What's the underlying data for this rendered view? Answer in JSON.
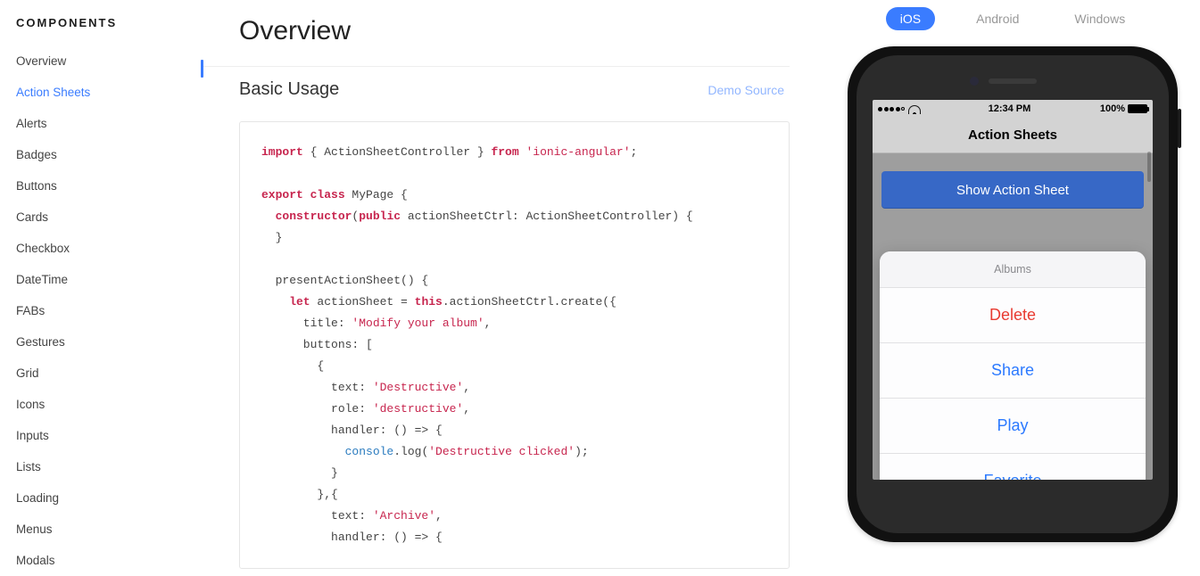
{
  "sidebar": {
    "title": "COMPONENTS",
    "items": [
      {
        "label": "Overview",
        "active": false
      },
      {
        "label": "Action Sheets",
        "active": true
      },
      {
        "label": "Alerts",
        "active": false
      },
      {
        "label": "Badges",
        "active": false
      },
      {
        "label": "Buttons",
        "active": false
      },
      {
        "label": "Cards",
        "active": false
      },
      {
        "label": "Checkbox",
        "active": false
      },
      {
        "label": "DateTime",
        "active": false
      },
      {
        "label": "FABs",
        "active": false
      },
      {
        "label": "Gestures",
        "active": false
      },
      {
        "label": "Grid",
        "active": false
      },
      {
        "label": "Icons",
        "active": false
      },
      {
        "label": "Inputs",
        "active": false
      },
      {
        "label": "Lists",
        "active": false
      },
      {
        "label": "Loading",
        "active": false
      },
      {
        "label": "Menus",
        "active": false
      },
      {
        "label": "Modals",
        "active": false
      }
    ]
  },
  "page": {
    "title": "Overview",
    "section": "Basic Usage",
    "demo_link": "Demo Source"
  },
  "code": {
    "l1_import": "import",
    "l1_mid": " { ActionSheetController } ",
    "l1_from": "from",
    "l1_str": " 'ionic-angular'",
    "l1_end": ";",
    "l2_export": "export",
    "l2_class": " class",
    "l2_rest": " MyPage {",
    "l3_ctor": "  constructor",
    "l3_paren": "(",
    "l3_public": "public",
    "l3_rest": " actionSheetCtrl: ActionSheetController) {",
    "l4": "  }",
    "l5": "  presentActionSheet() {",
    "l6_let": "    let",
    "l6_mid": " actionSheet = ",
    "l6_this": "this",
    "l6_rest": ".actionSheetCtrl.create({",
    "l7_a": "      title: ",
    "l7_str": "'Modify your album'",
    "l7_c": ",",
    "l8": "      buttons: [",
    "l9": "        {",
    "l10_a": "          text: ",
    "l10_str": "'Destructive'",
    "l10_c": ",",
    "l11_a": "          role: ",
    "l11_str": "'destructive'",
    "l11_c": ",",
    "l12": "          handler: () => {",
    "l13_a": "            ",
    "l13_fn": "console",
    "l13_b": ".log(",
    "l13_str": "'Destructive clicked'",
    "l13_c": ");",
    "l14": "          }",
    "l15": "        },{",
    "l16_a": "          text: ",
    "l16_str": "'Archive'",
    "l16_c": ",",
    "l17": "          handler: () => {"
  },
  "platforms": {
    "ios": "iOS",
    "android": "Android",
    "windows": "Windows"
  },
  "phone": {
    "time": "12:34 PM",
    "battery": "100%",
    "header": "Action Sheets",
    "show_button": "Show Action Sheet",
    "sheet_title": "Albums",
    "sheet_buttons": [
      {
        "label": "Delete",
        "destructive": true
      },
      {
        "label": "Share",
        "destructive": false
      },
      {
        "label": "Play",
        "destructive": false
      },
      {
        "label": "Favorite",
        "destructive": false
      }
    ]
  }
}
